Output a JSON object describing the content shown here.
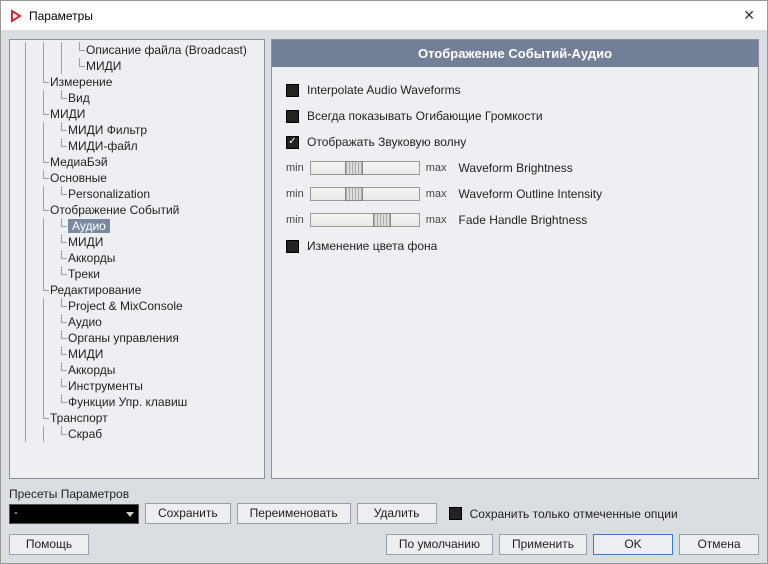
{
  "window": {
    "title": "Параметры"
  },
  "tree": [
    {
      "label": "Описание файла (Broadcast)",
      "level": 3
    },
    {
      "label": "МИДИ",
      "level": 3
    },
    {
      "label": "Измерение",
      "level": 1
    },
    {
      "label": "Вид",
      "level": 2
    },
    {
      "label": "МИДИ",
      "level": 1
    },
    {
      "label": "МИДИ Фильтр",
      "level": 2
    },
    {
      "label": "МИДИ-файл",
      "level": 2
    },
    {
      "label": "МедиаБэй",
      "level": 1
    },
    {
      "label": "Основные",
      "level": 1
    },
    {
      "label": "Personalization",
      "level": 2
    },
    {
      "label": "Отображение Событий",
      "level": 1
    },
    {
      "label": "Аудио",
      "level": 2,
      "selected": true
    },
    {
      "label": "МИДИ",
      "level": 2
    },
    {
      "label": "Аккорды",
      "level": 2
    },
    {
      "label": "Треки",
      "level": 2
    },
    {
      "label": "Редактирование",
      "level": 1
    },
    {
      "label": "Project & MixConsole",
      "level": 2
    },
    {
      "label": "Аудио",
      "level": 2
    },
    {
      "label": "Органы управления",
      "level": 2
    },
    {
      "label": "МИДИ",
      "level": 2
    },
    {
      "label": "Аккорды",
      "level": 2
    },
    {
      "label": "Инструменты",
      "level": 2
    },
    {
      "label": "Функции Упр. клавиш",
      "level": 2
    },
    {
      "label": "Транспорт",
      "level": 1
    },
    {
      "label": "Скраб",
      "level": 2
    }
  ],
  "content": {
    "header": "Отображение Событий-Аудио",
    "checks": {
      "interpolate": "Interpolate Audio Waveforms",
      "always_show": "Всегда показывать Огибающие Громкости",
      "show_wave": "Отображать Звуковую волну",
      "bg_color": "Изменение цвета фона"
    },
    "sliders": {
      "min": "min",
      "max": "max",
      "brightness": "Waveform Brightness",
      "outline": "Waveform Outline Intensity",
      "fade": "Fade Handle Brightness"
    }
  },
  "presets": {
    "label": "Пресеты Параметров",
    "selected": "-",
    "save": "Сохранить",
    "rename": "Переименовать",
    "delete": "Удалить",
    "save_marked": "Сохранить только отмеченные опции"
  },
  "footer": {
    "help": "Помощь",
    "defaults": "По умолчанию",
    "apply": "Применить",
    "ok": "OK",
    "cancel": "Отмена"
  }
}
